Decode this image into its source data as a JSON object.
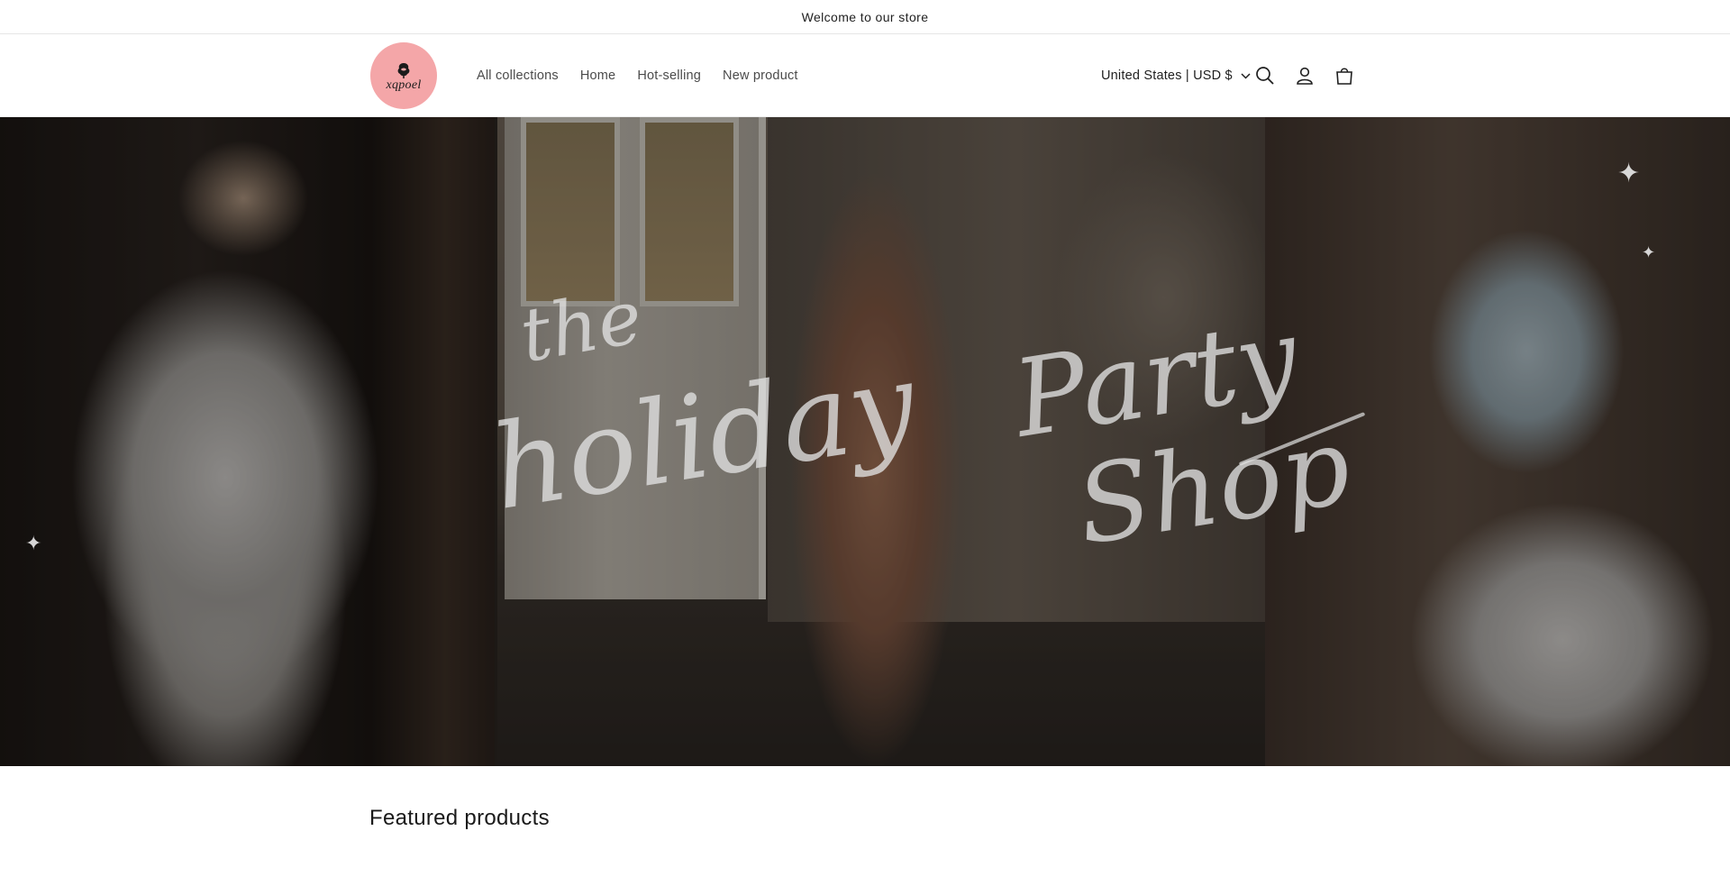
{
  "announcement": {
    "text": "Welcome to our store"
  },
  "header": {
    "logo_text": "xqpoel",
    "nav": [
      {
        "label": "All collections"
      },
      {
        "label": "Home"
      },
      {
        "label": "Hot-selling"
      },
      {
        "label": "New product"
      }
    ],
    "currency": "United States | USD $",
    "icons": [
      "search-icon",
      "account-icon",
      "cart-icon"
    ]
  },
  "hero": {
    "script_lines": [
      "the",
      "holiday",
      "Party",
      "Shop"
    ]
  },
  "featured": {
    "title": "Featured products"
  },
  "colors": {
    "logo_bg": "#f4a6a8",
    "text": "#121212",
    "nav_text": "#4b4b4b"
  }
}
